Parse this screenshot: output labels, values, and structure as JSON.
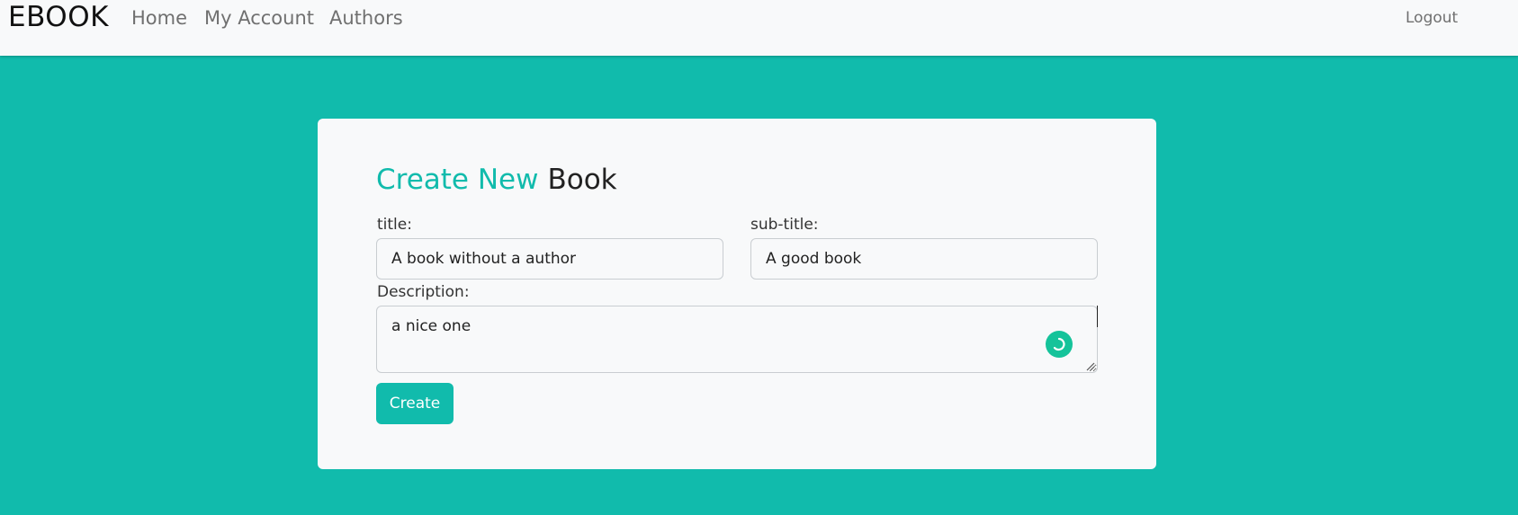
{
  "nav": {
    "brand": "EBOOK",
    "links": [
      "Home",
      "My Account",
      "Authors"
    ],
    "logout": "Logout"
  },
  "form": {
    "heading_accent": "Create New",
    "heading_main": "Book",
    "title_label": "title:",
    "title_value": "A book without a author",
    "subtitle_label": "sub-title:",
    "subtitle_value": "A good book",
    "description_label": "Description:",
    "description_value": "a nice one",
    "submit_label": "Create"
  },
  "colors": {
    "accent": "#11bbac",
    "navbar_bg": "#f8f9fa",
    "card_bg": "#f8f9fa",
    "grammar_icon": "#15c39a"
  },
  "icons": {
    "assistant": "grammar-assistant-icon",
    "resize": "resize-grip-icon"
  }
}
